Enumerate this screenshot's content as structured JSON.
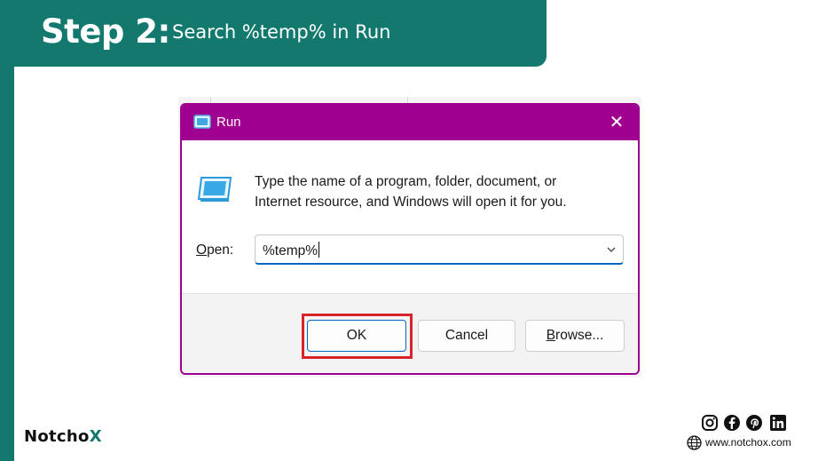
{
  "header": {
    "step_label": "Step 2:",
    "step_text": "Search %temp% in Run"
  },
  "run_dialog": {
    "title": "Run",
    "close_symbol": "✕",
    "description_line1": "Type the name of a program, folder, document, or",
    "description_line2": "Internet resource, and Windows will open it for you.",
    "open_label_accesskey": "O",
    "open_label_rest": "pen:",
    "open_value": "%temp%",
    "buttons": {
      "ok": "OK",
      "cancel": "Cancel",
      "browse_accesskey": "B",
      "browse_rest": "rowse..."
    },
    "highlight_color": "#d8232a",
    "titlebar_color": "#a0008f"
  },
  "branding": {
    "logo_main": "Notcho",
    "logo_x": "X",
    "website": "www.notchox.com",
    "socials": [
      "instagram-icon",
      "facebook-icon",
      "pinterest-icon",
      "linkedin-icon"
    ],
    "accent_color": "#13796f"
  }
}
